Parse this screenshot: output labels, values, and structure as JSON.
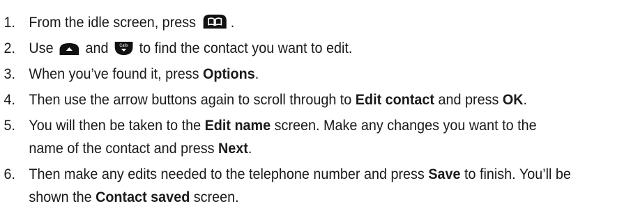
{
  "steps": [
    {
      "number": "1.",
      "text_before": "From the idle screen, press ",
      "icon": "phonebook-key-icon",
      "text_after": "."
    },
    {
      "number": "2.",
      "text_before": "Use ",
      "icon_up": "up-arrow-key-icon",
      "text_mid": " and ",
      "icon_down": "calls-down-key-icon",
      "text_after": " to find the contact you want to edit."
    },
    {
      "number": "3.",
      "text_before": "When you’ve found it, press ",
      "bold": "Options",
      "text_after": "."
    },
    {
      "number": "4.",
      "text_before": "Then use the arrow buttons again to scroll through to ",
      "bold": "Edit contact",
      "text_mid": " and press ",
      "bold2": "OK",
      "text_after": "."
    },
    {
      "number": "5.",
      "text_before": "You will then be taken to the ",
      "bold": "Edit name",
      "text_mid": " screen. Make any changes you want to the name of the contact and press ",
      "bold2": "Next",
      "text_after": "."
    },
    {
      "number": "6.",
      "text_before": "Then make any edits needed to the telephone number and press ",
      "bold": "Save",
      "text_mid": " to finish. You’ll be shown the ",
      "bold2": "Contact saved",
      "text_after": " screen."
    }
  ],
  "key_color": "#111111",
  "key_label_calls": "Calls"
}
